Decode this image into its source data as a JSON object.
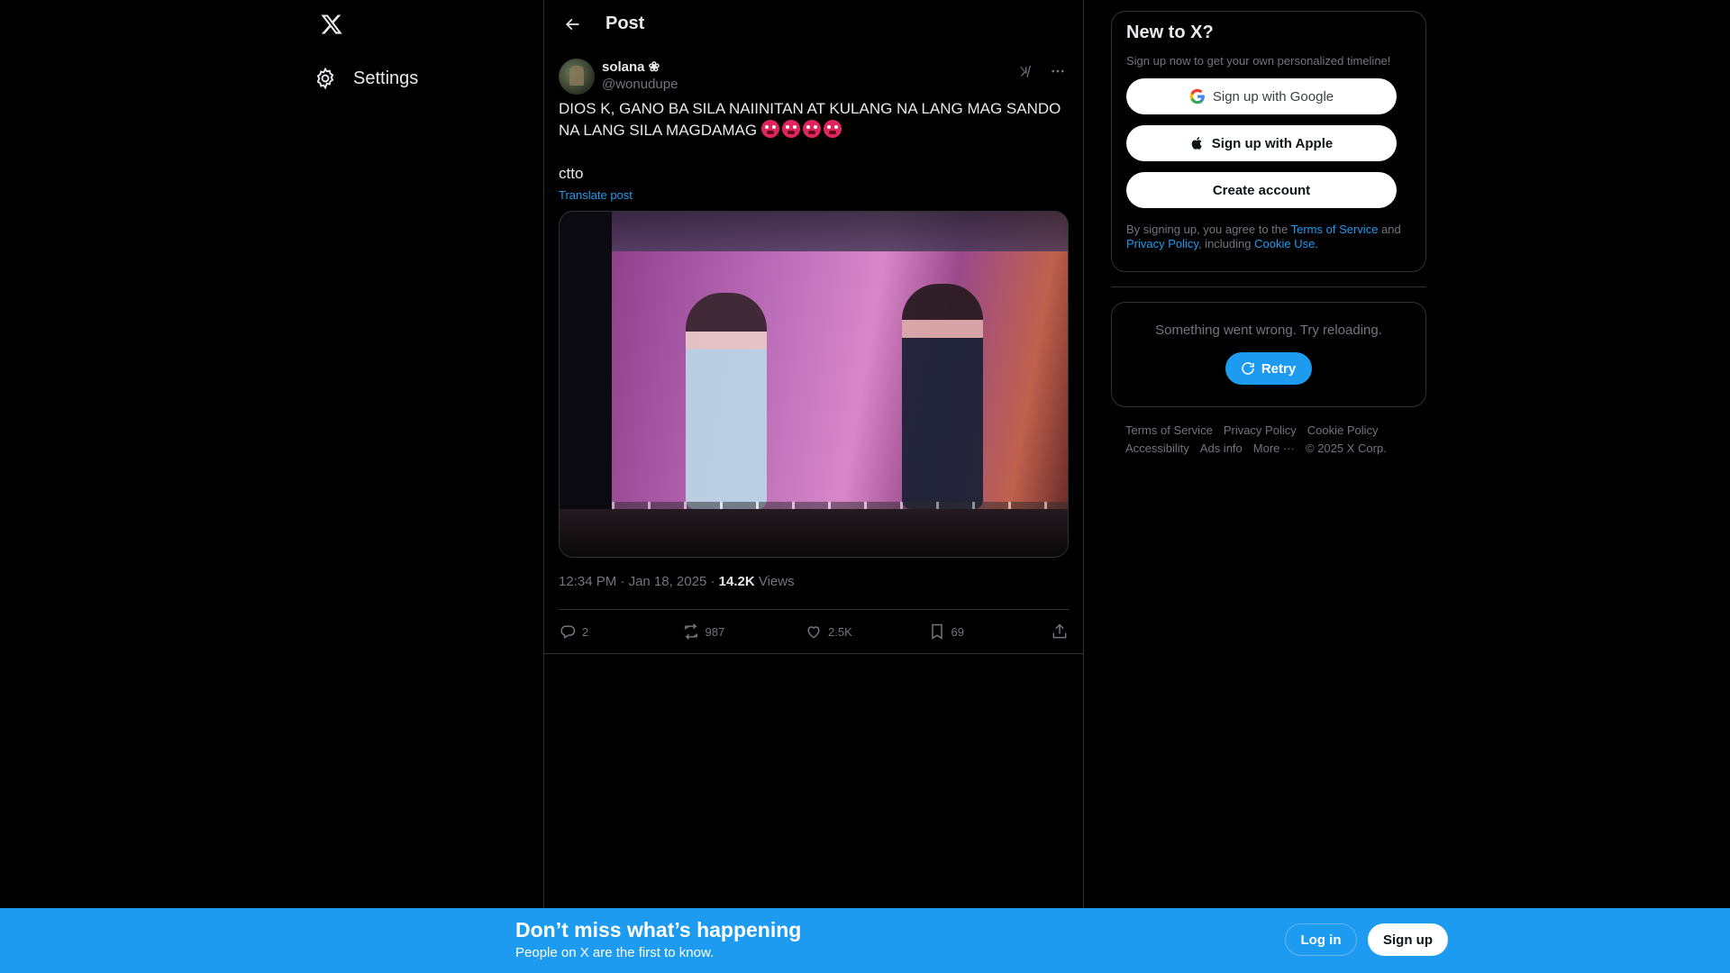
{
  "nav": {
    "logo_icon": "x-logo-icon",
    "settings_label": "Settings"
  },
  "header": {
    "title": "Post"
  },
  "tweet": {
    "display_name": "solana ❀",
    "handle": "@wonudupe",
    "text_line1": "DIOS K, GANO BA SILA NAIINITAN AT KULANG NA LANG MAG SANDO NA LANG SILA MAGDAMAG",
    "emoji_count": 4,
    "text_line2": "ctto",
    "translate_label": "Translate post",
    "time": "12:34 PM",
    "date": "Jan 18, 2025",
    "views_count": "14.2K",
    "views_label": "Views",
    "separator": "·",
    "actions": {
      "replies": "2",
      "reposts": "987",
      "likes": "2.5K",
      "bookmarks": "69"
    }
  },
  "signup": {
    "title": "New to X?",
    "subtitle": "Sign up now to get your own personalized timeline!",
    "google_label": "Sign up with Google",
    "apple_label": "Sign up with Apple",
    "create_label": "Create account",
    "legal_prefix": "By signing up, you agree to the",
    "terms_link": "Terms of Service",
    "and": "and",
    "privacy_link": "Privacy Policy",
    "including": ", including",
    "cookie_link": "Cookie Use."
  },
  "error_card": {
    "message": "Something went wrong. Try reloading.",
    "retry_label": "Retry"
  },
  "footer": {
    "links": [
      "Terms of Service",
      "Privacy Policy",
      "Cookie Policy",
      "Accessibility",
      "Ads info",
      "More ···",
      "© 2025 X Corp."
    ]
  },
  "bottom_bar": {
    "title": "Don’t miss what’s happening",
    "subtitle": "People on X are the first to know.",
    "login_label": "Log in",
    "signup_label": "Sign up"
  },
  "colors": {
    "accent": "#1d9bf0",
    "background": "#000000",
    "muted_text": "#71767b",
    "border": "#2f3336"
  }
}
